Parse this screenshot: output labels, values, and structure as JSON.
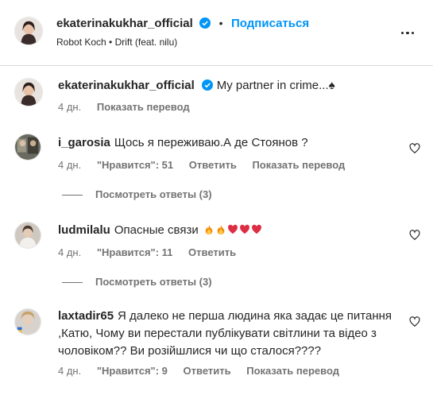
{
  "header": {
    "username": "ekaterinakukhar_official",
    "separator": "•",
    "follow_label": "Подписаться",
    "song": "Robot Koch • Drift (feat. nilu)"
  },
  "caption": {
    "username": "ekaterinakukhar_official",
    "text": "My partner in crime...",
    "text_emoji": "♠",
    "time": "4 дн.",
    "translate": "Показать перевод"
  },
  "comments": [
    {
      "username": "i_garosia",
      "text": "Щось я переживаю.А де Стоянов ?",
      "time": "4 дн.",
      "likes": "\"Нравится\": 51",
      "reply": "Ответить",
      "translate": "Показать перевод",
      "view_replies": "Посмотреть ответы (3)"
    },
    {
      "username": "ludmilalu",
      "text": "Опасные связи",
      "emojis": [
        "fire-emoji",
        "fire-emoji",
        "heart-emoji",
        "heart-emoji",
        "heart-emoji"
      ],
      "time": "4 дн.",
      "likes": "\"Нравится\": 11",
      "reply": "Ответить",
      "view_replies": "Посмотреть ответы (3)"
    },
    {
      "username": "laxtadir65",
      "text_line1": "Я далеко не перша людина яка задає це питання",
      "text_line2": ",Катю, Чому ви перестали публікувати світлини та відео з",
      "text_line3": "чоловіком?? Ви розійшлися чи що сталося????",
      "time": "4 дн.",
      "likes": "\"Нравится\": 9",
      "reply": "Ответить",
      "translate": "Показать перевод"
    }
  ],
  "colors": {
    "accent": "#0095f6",
    "text": "#262626",
    "secondary": "#737373",
    "divider": "#dbdbdb",
    "heart_red": "#ed4956"
  }
}
